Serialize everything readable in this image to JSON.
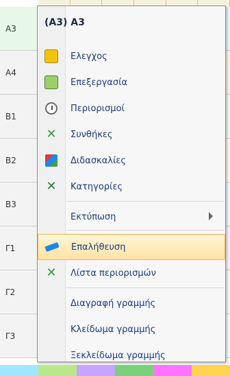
{
  "grid": {
    "row_headers": [
      "A3",
      "A4",
      "B1",
      "B2",
      "B3",
      "Γ1",
      "Γ2",
      "Γ3"
    ]
  },
  "menu": {
    "title": "(A3) A3",
    "items": [
      {
        "label": "Ελεγχος",
        "icon": "checklist-icon"
      },
      {
        "label": "Επεξεργασία",
        "icon": "edit-people-icon"
      },
      {
        "label": "Περιορισμοί",
        "icon": "clock-icon"
      },
      {
        "label": "Συνθήκες",
        "icon": "green-x-icon"
      },
      {
        "label": "Διδασκαλίες",
        "icon": "colored-books-icon"
      },
      {
        "label": "Κατηγορίες",
        "icon": "green-x2-icon"
      },
      {
        "label": "Εκτύπωση",
        "icon": "",
        "has_submenu": true
      },
      {
        "label": "Επαλήθευση",
        "icon": "pencil-icon",
        "highlighted": true
      },
      {
        "label": "Λίστα περιορισμών",
        "icon": "green-x3-icon"
      },
      {
        "label": "Διαγραφή γραμμής",
        "icon": ""
      },
      {
        "label": "Κλείδωμα γραμμής",
        "icon": ""
      },
      {
        "label": "Ξεκλείδωμα γραμμής",
        "icon": ""
      }
    ]
  },
  "colors": {
    "highlight_bg": "#ffe3a3",
    "menu_text": "#1a3b7a"
  }
}
